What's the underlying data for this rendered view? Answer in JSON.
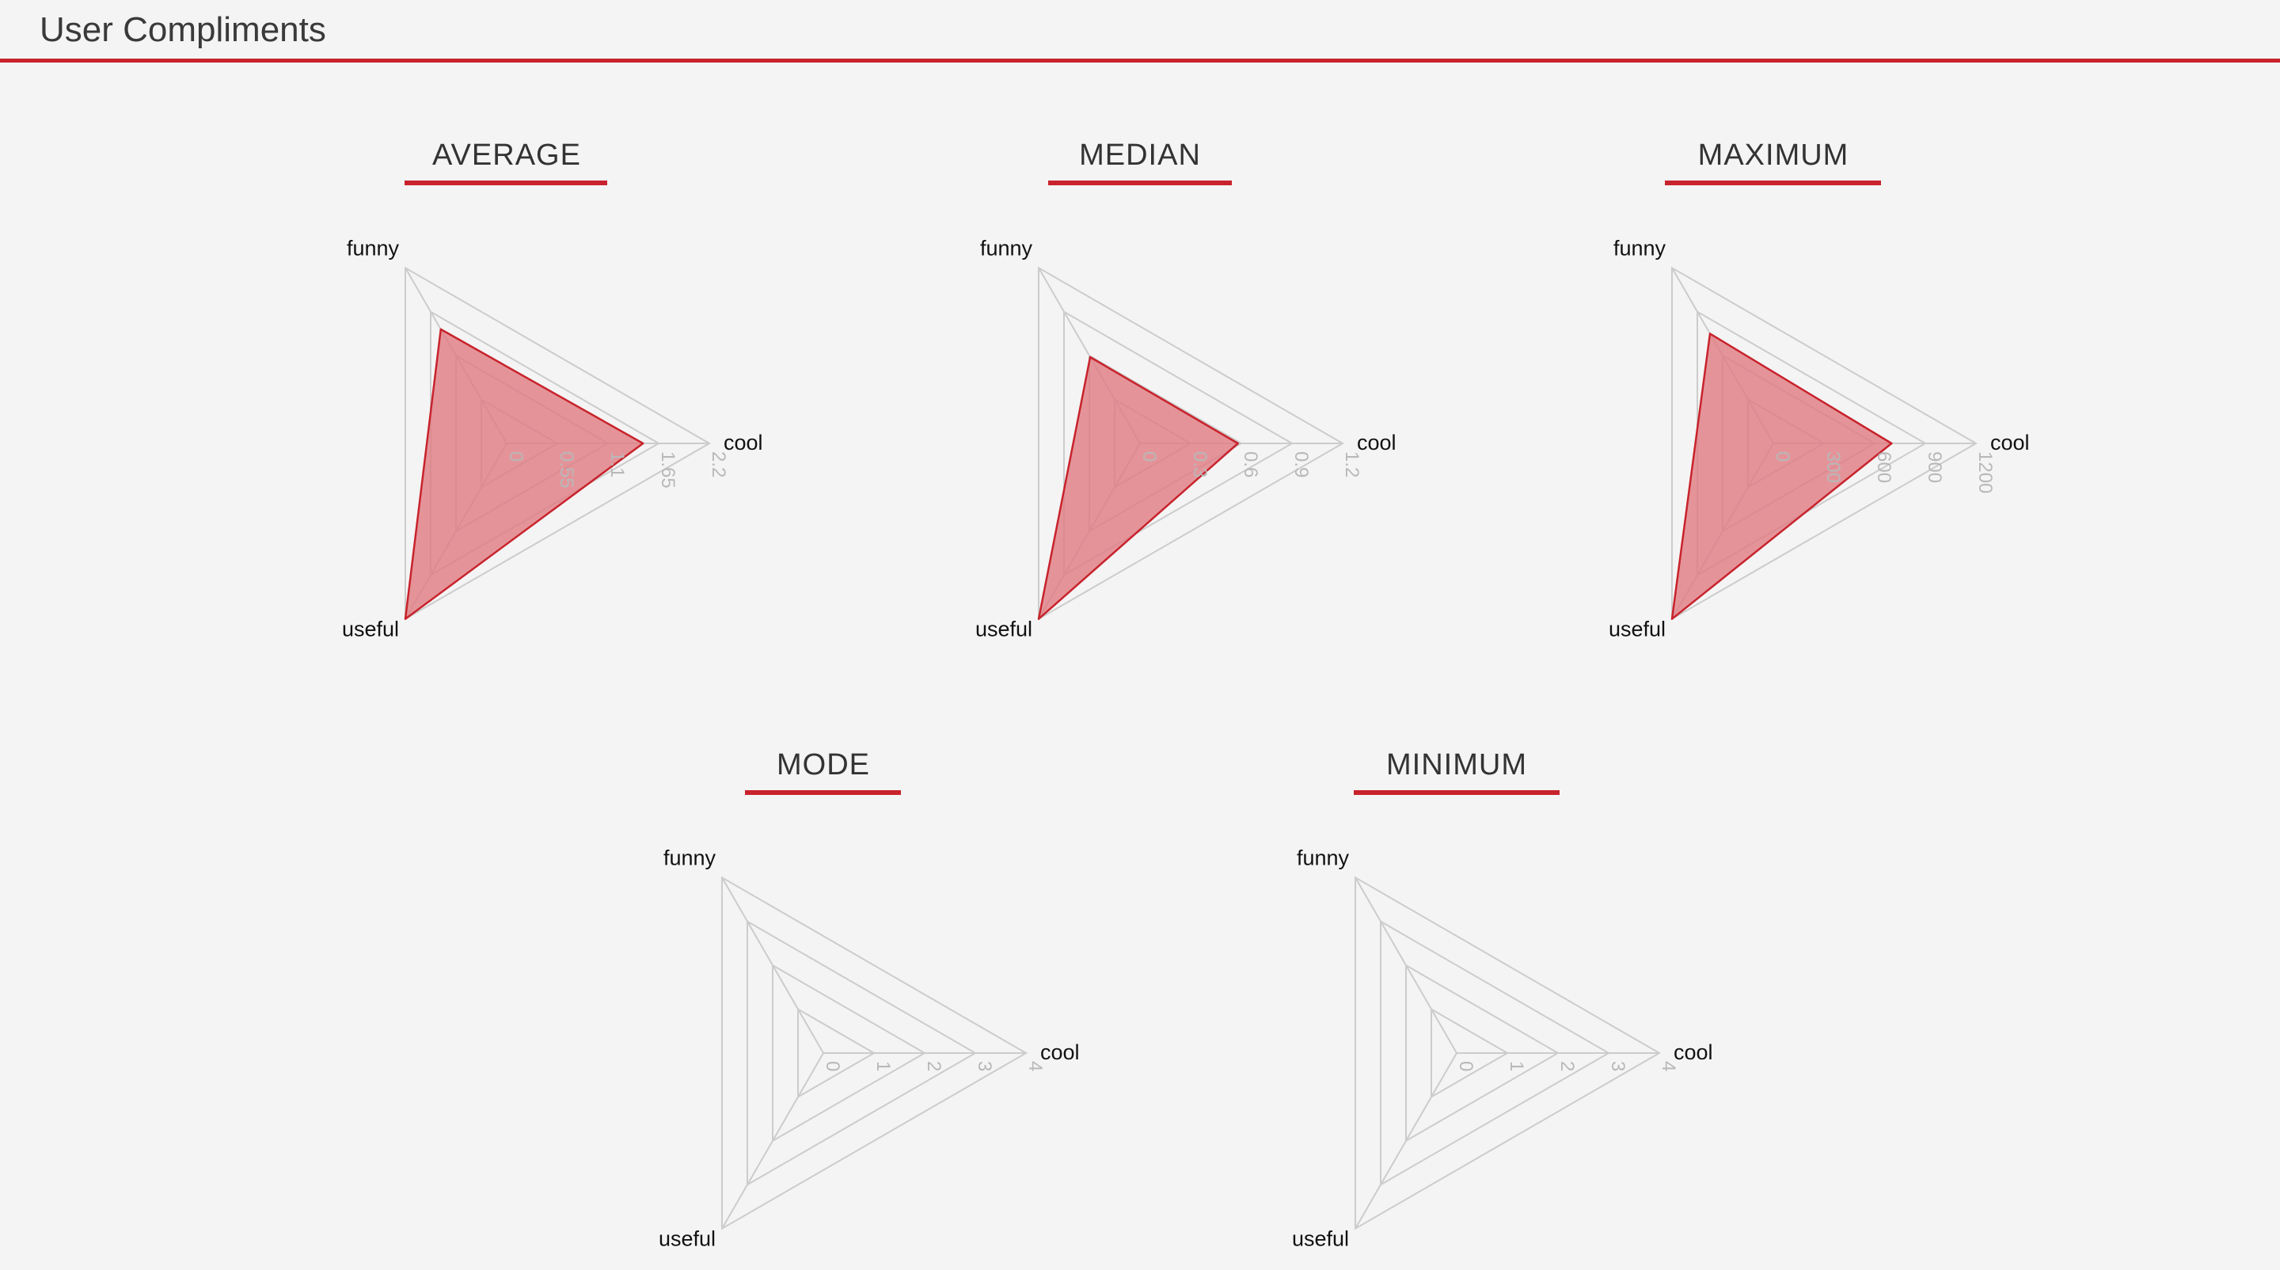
{
  "header": {
    "title": "User Compliments"
  },
  "colors": {
    "accent": "#c8232c",
    "fill": "#e07c82",
    "grid": "#cccccc",
    "tick": "#b8b8b8"
  },
  "chart_data": [
    {
      "type": "radar",
      "title": "AVERAGE",
      "axes": [
        "cool",
        "funny",
        "useful"
      ],
      "ticks": [
        "0",
        "0.55",
        "1.1",
        "1.65",
        "2.2"
      ],
      "rmax": 2.2,
      "series": [
        {
          "values": [
            1.48,
            1.43,
            2.2
          ]
        }
      ]
    },
    {
      "type": "radar",
      "title": "MEDIAN",
      "axes": [
        "cool",
        "funny",
        "useful"
      ],
      "ticks": [
        "0",
        "0.3",
        "0.6",
        "0.9",
        "1.2"
      ],
      "rmax": 1.2,
      "series": [
        {
          "values": [
            0.58,
            0.59,
            1.2
          ]
        }
      ]
    },
    {
      "type": "radar",
      "title": "MAXIMUM",
      "axes": [
        "cool",
        "funny",
        "useful"
      ],
      "ticks": [
        "0",
        "300",
        "600",
        "900",
        "1200"
      ],
      "rmax": 1200,
      "series": [
        {
          "values": [
            700,
            750,
            1200
          ]
        }
      ]
    },
    {
      "type": "radar",
      "title": "MODE",
      "axes": [
        "cool",
        "funny",
        "useful"
      ],
      "ticks": [
        "0",
        "1",
        "2",
        "3",
        "4"
      ],
      "rmax": 4,
      "series": [
        {
          "values": [
            0,
            0,
            0
          ]
        }
      ]
    },
    {
      "type": "radar",
      "title": "MINIMUM",
      "axes": [
        "cool",
        "funny",
        "useful"
      ],
      "ticks": [
        "0",
        "1",
        "2",
        "3",
        "4"
      ],
      "rmax": 4,
      "series": [
        {
          "values": [
            0,
            0,
            0
          ]
        }
      ]
    }
  ]
}
